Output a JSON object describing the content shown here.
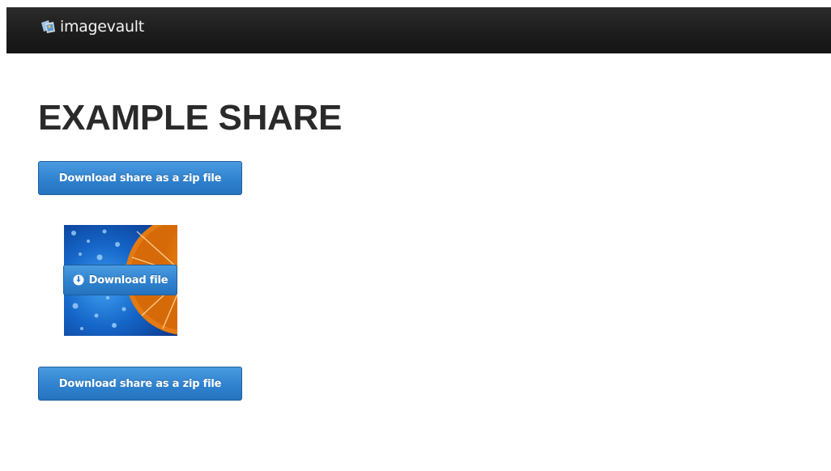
{
  "header": {
    "brand_name": "imagevault",
    "logo_icon": "imagevault-logo-icon"
  },
  "main": {
    "title": "EXAMPLE SHARE",
    "download_zip_label": "Download share as a zip file",
    "files": [
      {
        "thumbnail": "orange-in-water-image",
        "download_label": "Download file",
        "download_icon": "download-circle-icon"
      }
    ],
    "download_zip_label_bottom": "Download share as a zip file"
  },
  "colors": {
    "navbar": "#1d1d1d",
    "title": "#2a2a2a",
    "button": "#2f82cf",
    "button_border": "#1f5e9b"
  }
}
